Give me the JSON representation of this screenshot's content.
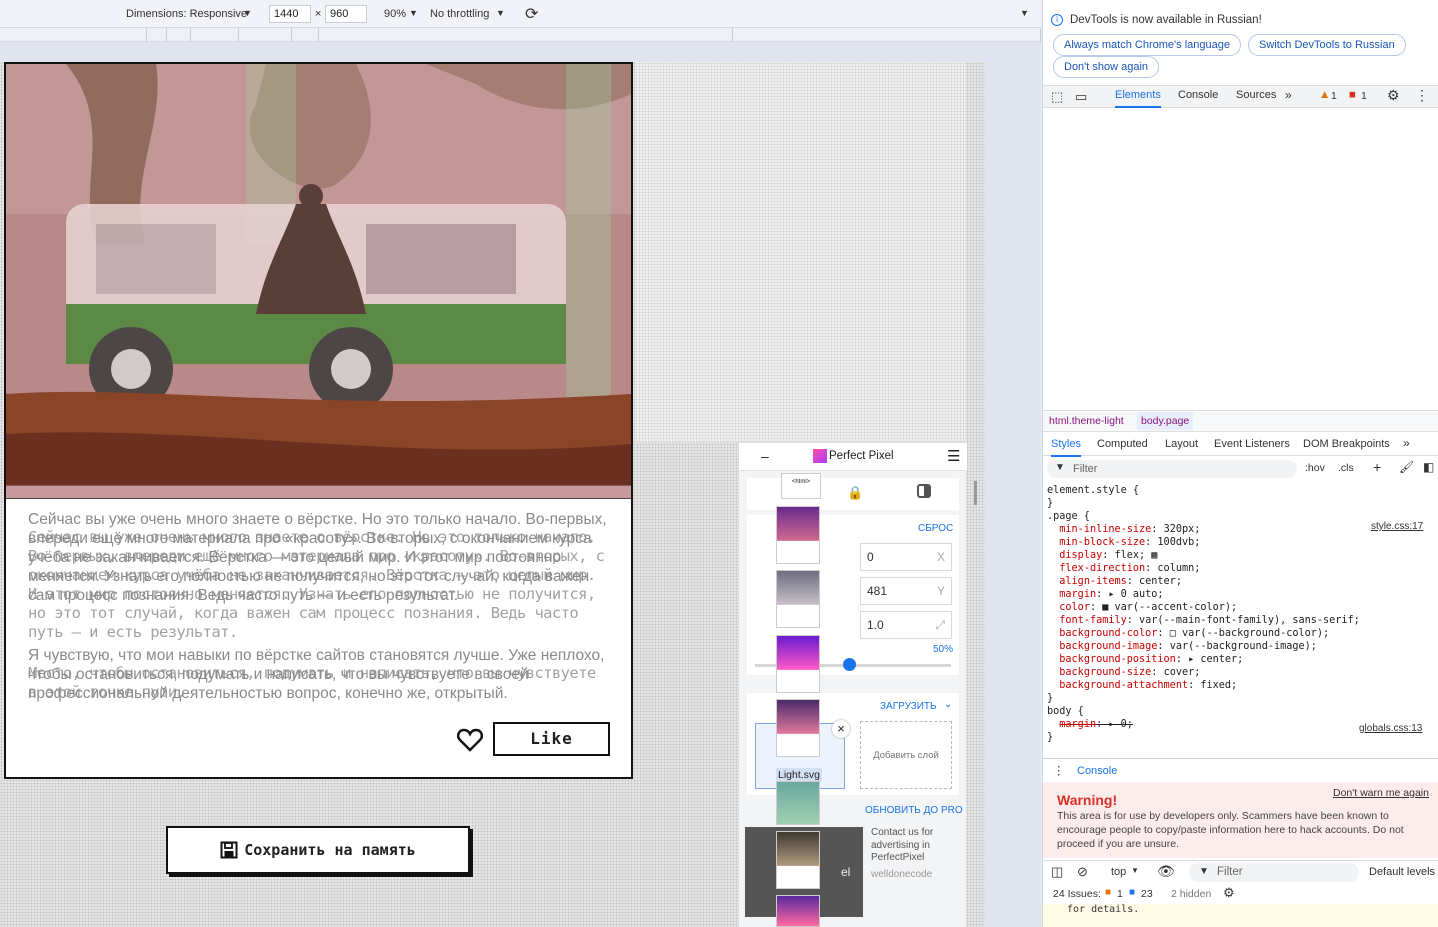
{
  "device_toolbar": {
    "dimensions_label": "Dimensions: Responsive",
    "width": "1440",
    "times": "×",
    "height": "960",
    "zoom": "90%",
    "throttling": "No throttling"
  },
  "page": {
    "paragraph_1": "Сейчас вы уже очень много знаете о вёрстке. Но это только начало. Во-первых, впереди ещё много материала про «красоту». Во-вторых, с окончанием курса учёба не заканчивается. Вёрстка — это целый мир. И этот мир постоянно меняется. Узнать его полностью не получится, но это тот случай, когда важен сам процесс познания. Ведь часто путь — и есть результат.",
    "paragraph_1_ghost": "Сейчас вы уже очень много знаете о вёрстке. Но это только начало. Во-первых, впереди ещё много материала про «красоту». Во-вторых, с окончанием курса учёба не заканчивается. Вёрстка — это целый мир. И этот мир постоянно меняется. Узнать его полностью не получится, но это тот случай, когда важен сам процесс познания. Ведь часто путь — и есть результат.",
    "paragraph_2": "Я чувствую, что мои навыки по вёрстке сайтов становятся лучше. Уже неплохо, чтобы остановиться, подумать и написать, что вы чувствуете в своей профессиональной деятельностью вопрос, конечно же, открытый.",
    "paragraph_2_ghost": "Место, чтобы остановиться, подумать и написать, что вы чувствуете в этой точке пути.",
    "like_label": "Like",
    "save_label": "Сохранить на память"
  },
  "perfect_pixel": {
    "title": "Perfect Pixel",
    "reset": "СБРОС",
    "x_value": "0",
    "x_label": "X",
    "y_value": "481",
    "y_label": "Y",
    "scale_value": "1.0",
    "opacity": "50%",
    "upload": "ЗАГРУЗИТЬ",
    "layer_name": "Light.svg",
    "add_layer": "Добавить слой",
    "upgrade": "ОБНОВИТЬ ДО PRO",
    "ad_text": "Contact us for advertising in PerfectPixel",
    "ad_brand": "welldonecode",
    "ad_letters": "el"
  },
  "devtools": {
    "notice": "DevTools is now available in Russian!",
    "btn_match": "Always match Chrome's language",
    "btn_switch": "Switch DevTools to Russian",
    "btn_dont_show": "Don't show again",
    "tabs": [
      "Elements",
      "Console",
      "Sources"
    ],
    "warn_count": "1",
    "err_count": "1",
    "breadcrumb_html": "html.theme-light",
    "breadcrumb_body": "body.page",
    "style_tabs": [
      "Styles",
      "Computed",
      "Layout",
      "Event Listeners",
      "DOM Breakpoints"
    ],
    "filter_placeholder": "Filter",
    "hov": ":hov",
    "cls": ".cls",
    "style_source_1": "style.css:17",
    "style_source_2": "globals.css:13",
    "console_tab": "Console",
    "warning_title": "Warning!",
    "warn_link": "Don't warn me again",
    "warning_text": "This area is for use by developers only. Scammers have been known to encourage people to copy/paste information here to hack accounts. Do not proceed if you are unsure.",
    "context": "top",
    "console_filter": "Filter",
    "levels": "Default levels",
    "issues": "24 Issues:",
    "issues_warn": "1",
    "issues_info": "23",
    "hidden": "2 hidden",
    "tail": "for details."
  },
  "colors": {
    "accent": "#1a73e8",
    "ink": "#111111",
    "pp_pink": "#ff4fa0"
  }
}
